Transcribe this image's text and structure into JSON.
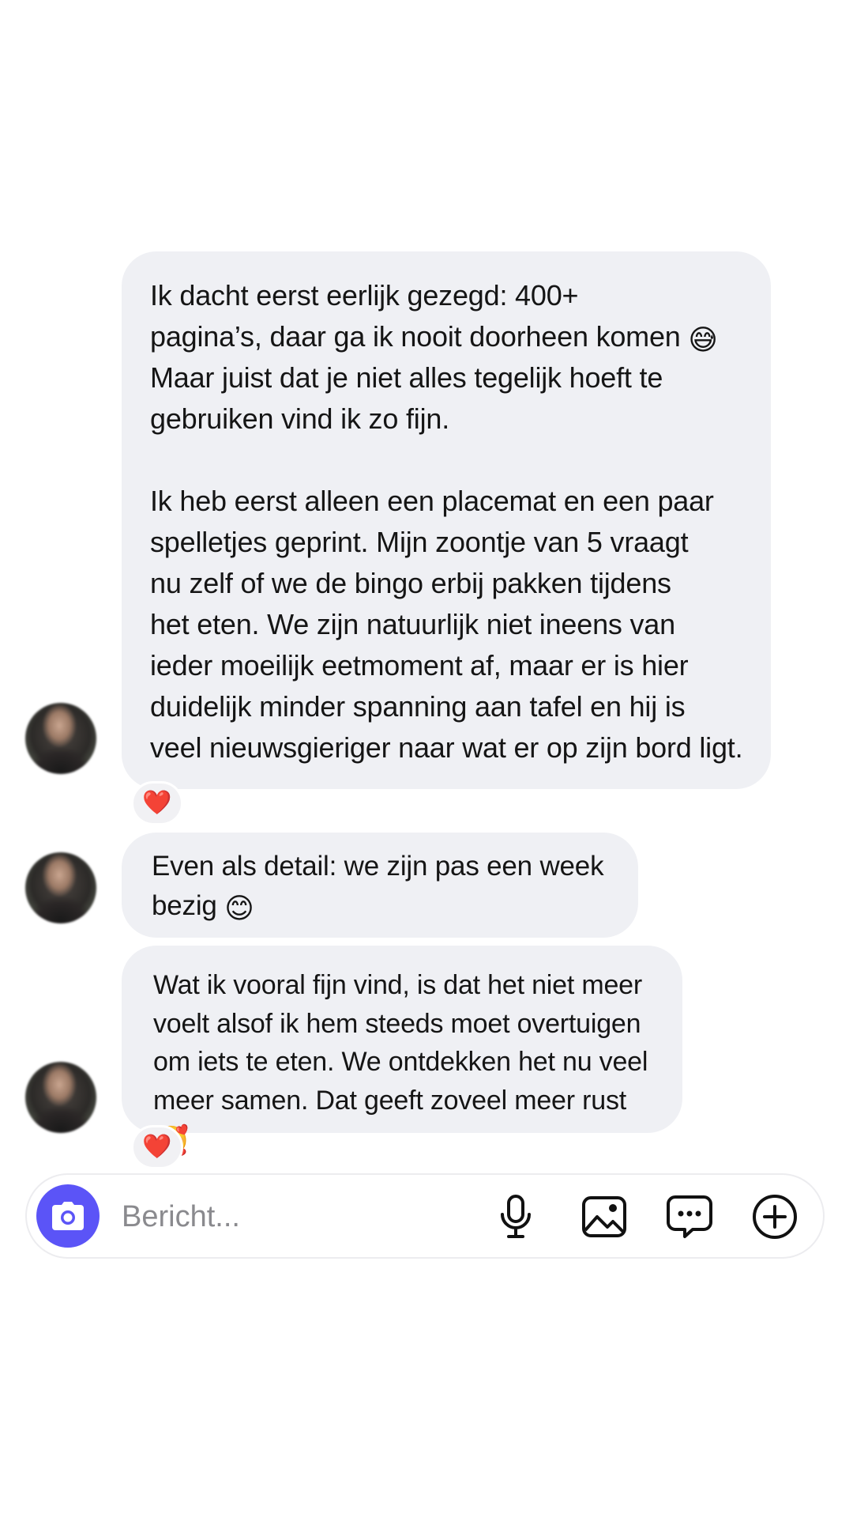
{
  "messages": [
    {
      "text_before": "Ik dacht eerst eerlijk gezegd: 400+\npagina’s, daar ga ik nooit doorheen komen ",
      "emoji": "😅",
      "text_after": "\nMaar juist dat je niet alles tegelijk hoeft te\ngebruiken vind ik zo fijn.\n\nIk heb eerst alleen een placemat en een paar\nspelletjes geprint. Mijn zoontje van 5 vraagt\nnu zelf of we de bingo erbij pakken tijdens\nhet eten. We zijn natuurlijk niet ineens van\nieder moeilijk eetmoment af, maar er is hier\nduidelijk minder spanning aan tafel en hij is\nveel nieuwsgieriger naar wat er op zijn bord ligt.",
      "reaction": "❤️"
    },
    {
      "text_before": "Even als detail: we zijn pas een week\nbezig ",
      "emoji": "😊",
      "text_after": ""
    },
    {
      "text_before": "Wat ik vooral fijn vind, is dat het niet meer\nvoelt alsof ik hem steeds moet overtuigen\nom iets te eten. We ontdekken het nu veel\nmeer samen. Dat geeft zoveel meer rust ",
      "emoji": "🥰",
      "text_after": "",
      "reaction": "❤️"
    }
  ],
  "composer": {
    "placeholder": "Bericht...",
    "camera_icon": "camera-icon",
    "mic_icon": "microphone-icon",
    "gallery_icon": "image-icon",
    "sticker_icon": "chat-bubble-icon",
    "plus_icon": "plus-circle-icon"
  },
  "colors": {
    "bubble": "#eff0f4",
    "camera_button": "#5b54f7",
    "heart": "#e8283c",
    "placeholder": "#8a8a8e"
  }
}
